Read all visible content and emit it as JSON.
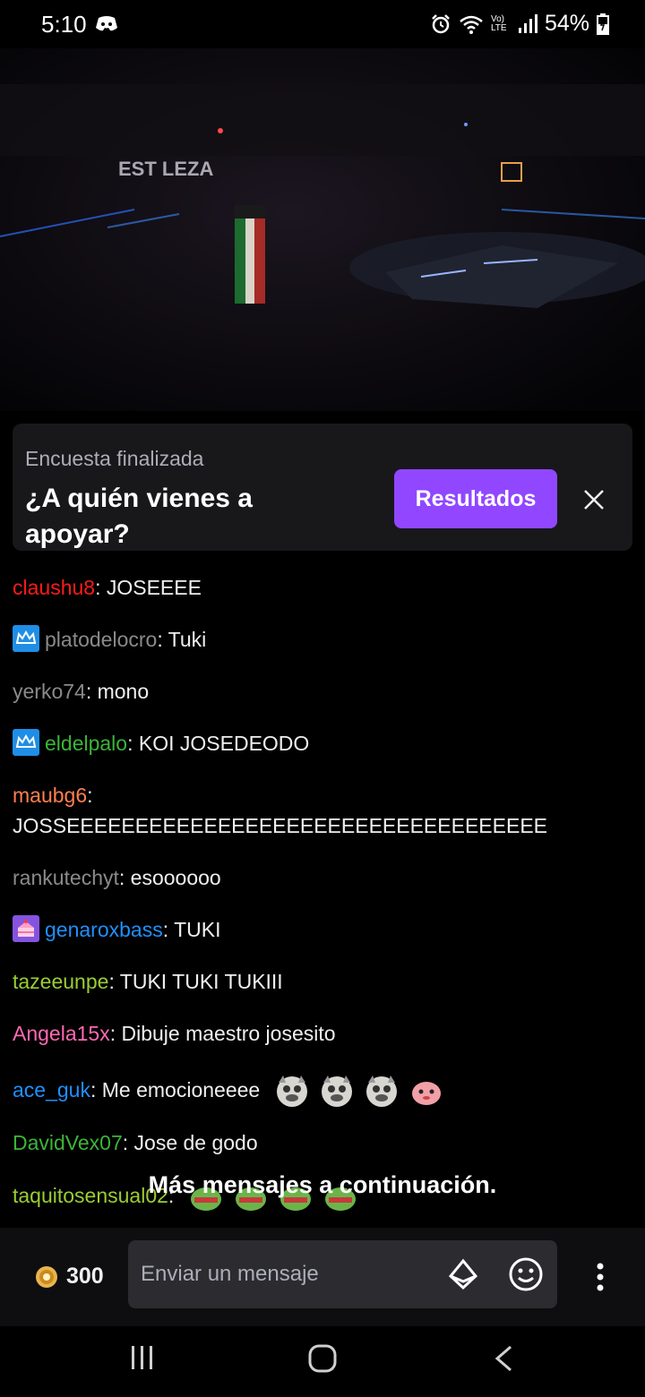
{
  "status_bar": {
    "time": "5:10",
    "network_label": "Vo) LTE",
    "battery": "54%"
  },
  "poll": {
    "status": "Encuesta finalizada",
    "question": "¿A quién vienes a apoyar?",
    "results_button": "Resultados"
  },
  "chat": {
    "messages": [
      {
        "user": "claushu8",
        "color": "#ff1a1a",
        "badge": "",
        "text": ": JOSEEEE"
      },
      {
        "user": "platodelocro",
        "color": "#8a8a8a",
        "badge": "prime",
        "text": ": Tuki"
      },
      {
        "user": "yerko74",
        "color": "#8a8a8a",
        "badge": "",
        "text": ": mono"
      },
      {
        "user": "eldelpalo",
        "color": "#3bb537",
        "badge": "prime",
        "text": ": KOI JOSEDEODO"
      },
      {
        "user": "maubg6",
        "color": "#ff7f50",
        "badge": "",
        "text": ":"
      },
      {
        "user": "",
        "color": "#efeff1",
        "badge": "",
        "text": "JOSSEEEEEEEEEEEEEEEEEEEEEEEEEEEEEEEEEEE"
      },
      {
        "user": "rankutechyt",
        "color": "#8a8a8a",
        "badge": "",
        "text": ": esoooooo"
      },
      {
        "user": "genaroxbass",
        "color": "#1e90ff",
        "badge": "cake",
        "text": ": TUKI"
      },
      {
        "user": "tazeeunpe",
        "color": "#9acd32",
        "badge": "",
        "text": ": TUKI TUKI TUKIII"
      },
      {
        "user": "Angela15x",
        "color": "#ff69b4",
        "badge": "",
        "text": ": Dibuje maestro josesito"
      },
      {
        "user": "ace_guk",
        "color": "#1e90ff",
        "badge": "",
        "text": ": Me emocioneeee"
      },
      {
        "user": "DavidVex07",
        "color": "#3bb537",
        "badge": "",
        "text": ": Jose de godo"
      },
      {
        "user": "taquitosensual02",
        "color": "#9acd32",
        "badge": "",
        "text": ":"
      }
    ],
    "more_banner": "Más mensajes a continuación."
  },
  "input_bar": {
    "bits_count": "300",
    "placeholder": "Enviar un mensaje"
  },
  "icons": {
    "discord": "discord-icon",
    "alarm": "alarm-icon",
    "wifi": "wifi-icon",
    "signal": "signal-icon",
    "battery": "battery-icon",
    "close": "close-icon",
    "bits": "bits-icon",
    "emoji": "emoji-icon",
    "more": "more-vertical-icon"
  },
  "colors": {
    "accent": "#9147ff",
    "card_bg": "#18181b",
    "input_bg": "#2b2b30"
  }
}
